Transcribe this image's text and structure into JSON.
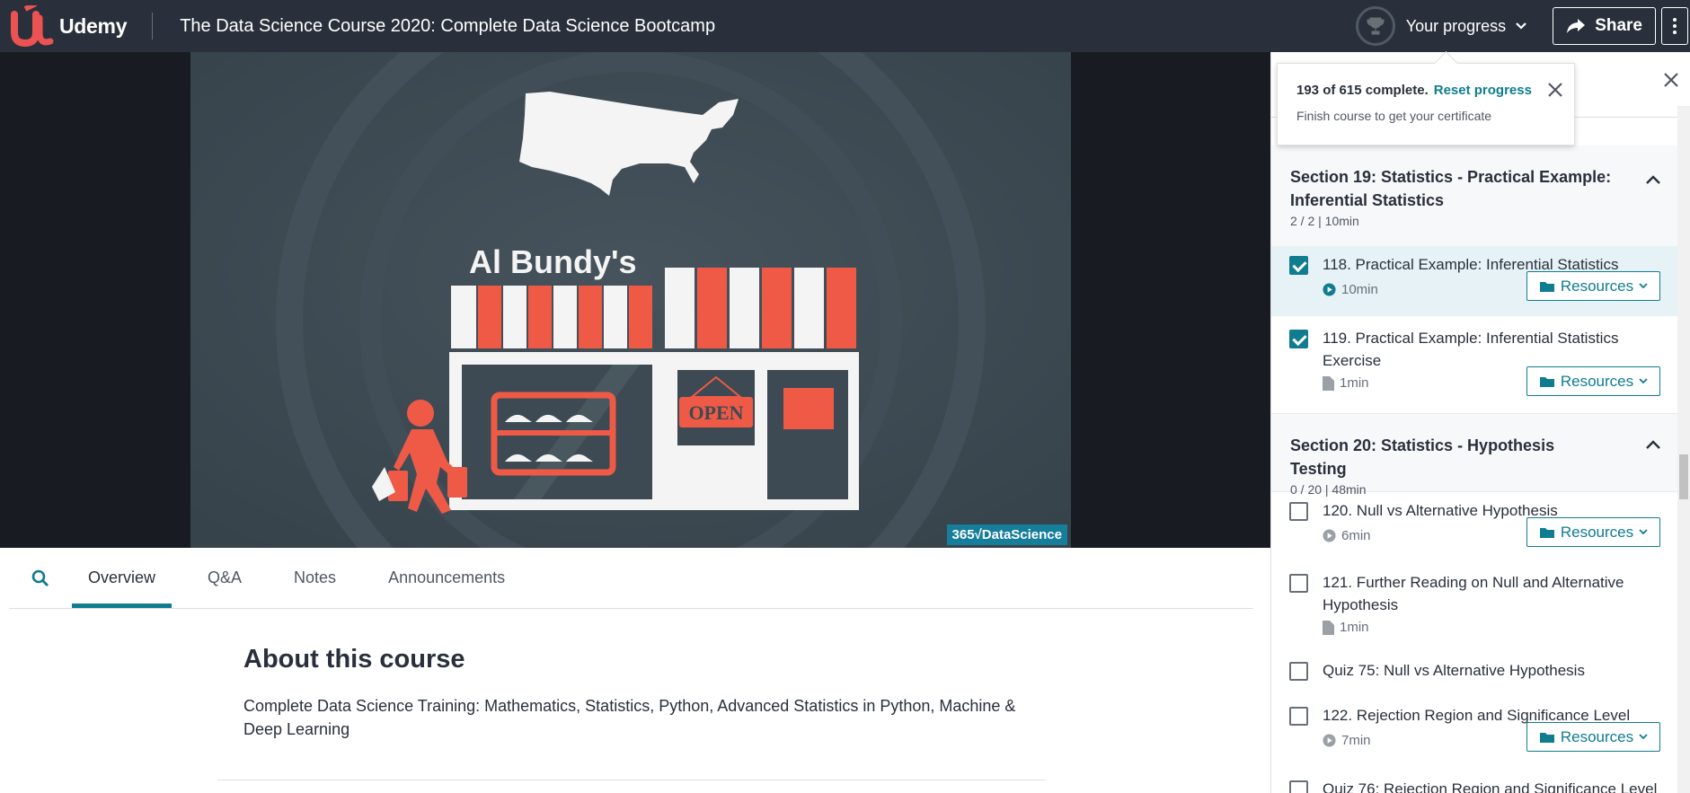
{
  "header": {
    "brand": "Udemy",
    "course_title": "The Data Science Course 2020: Complete Data Science Bootcamp",
    "progress_label": "Your progress",
    "share_label": "Share"
  },
  "video": {
    "store_sign": "Al Bundy's",
    "open_sign": "OPEN",
    "watermark": "365√DataScience"
  },
  "tabs": [
    "Overview",
    "Q&A",
    "Notes",
    "Announcements"
  ],
  "about": {
    "heading": "About this course",
    "description": "Complete Data Science Training: Mathematics, Statistics, Python, Advanced Statistics in Python, Machine & Deep Learning"
  },
  "progress_popover": {
    "status": "193 of 615 complete.",
    "reset_label": "Reset progress",
    "hint": "Finish course to get your certificate"
  },
  "sections": [
    {
      "title": "Section 19: Statistics - Practical Example: Inferential Statistics",
      "meta": "2 / 2 | 10min",
      "items": [
        {
          "title": "118. Practical Example: Inferential Statistics",
          "duration": "10min",
          "checked": true,
          "resources": "Resources"
        },
        {
          "title": "119. Practical Example: Inferential Statistics Exercise",
          "duration": "1min",
          "checked": true,
          "resources": "Resources"
        }
      ]
    },
    {
      "title": "Section 20: Statistics - Hypothesis Testing",
      "meta": "0 / 20 | 48min",
      "items": [
        {
          "title": "120. Null vs Alternative Hypothesis",
          "duration": "6min",
          "checked": false,
          "resources": "Resources"
        },
        {
          "title": "121. Further Reading on Null and Alternative Hypothesis",
          "duration": "1min",
          "checked": false
        },
        {
          "title": "Quiz 75: Null vs Alternative Hypothesis",
          "checked": false
        },
        {
          "title": "122. Rejection Region and Significance Level",
          "duration": "7min",
          "checked": false,
          "resources": "Resources"
        },
        {
          "title": "Quiz 76: Rejection Region and Significance Level",
          "checked": false
        }
      ]
    }
  ],
  "colors": {
    "header_bg": "#29303b",
    "accent": "#0f7c90",
    "udemy_red": "#ec5252",
    "slide_bg": "#3d4a53"
  }
}
